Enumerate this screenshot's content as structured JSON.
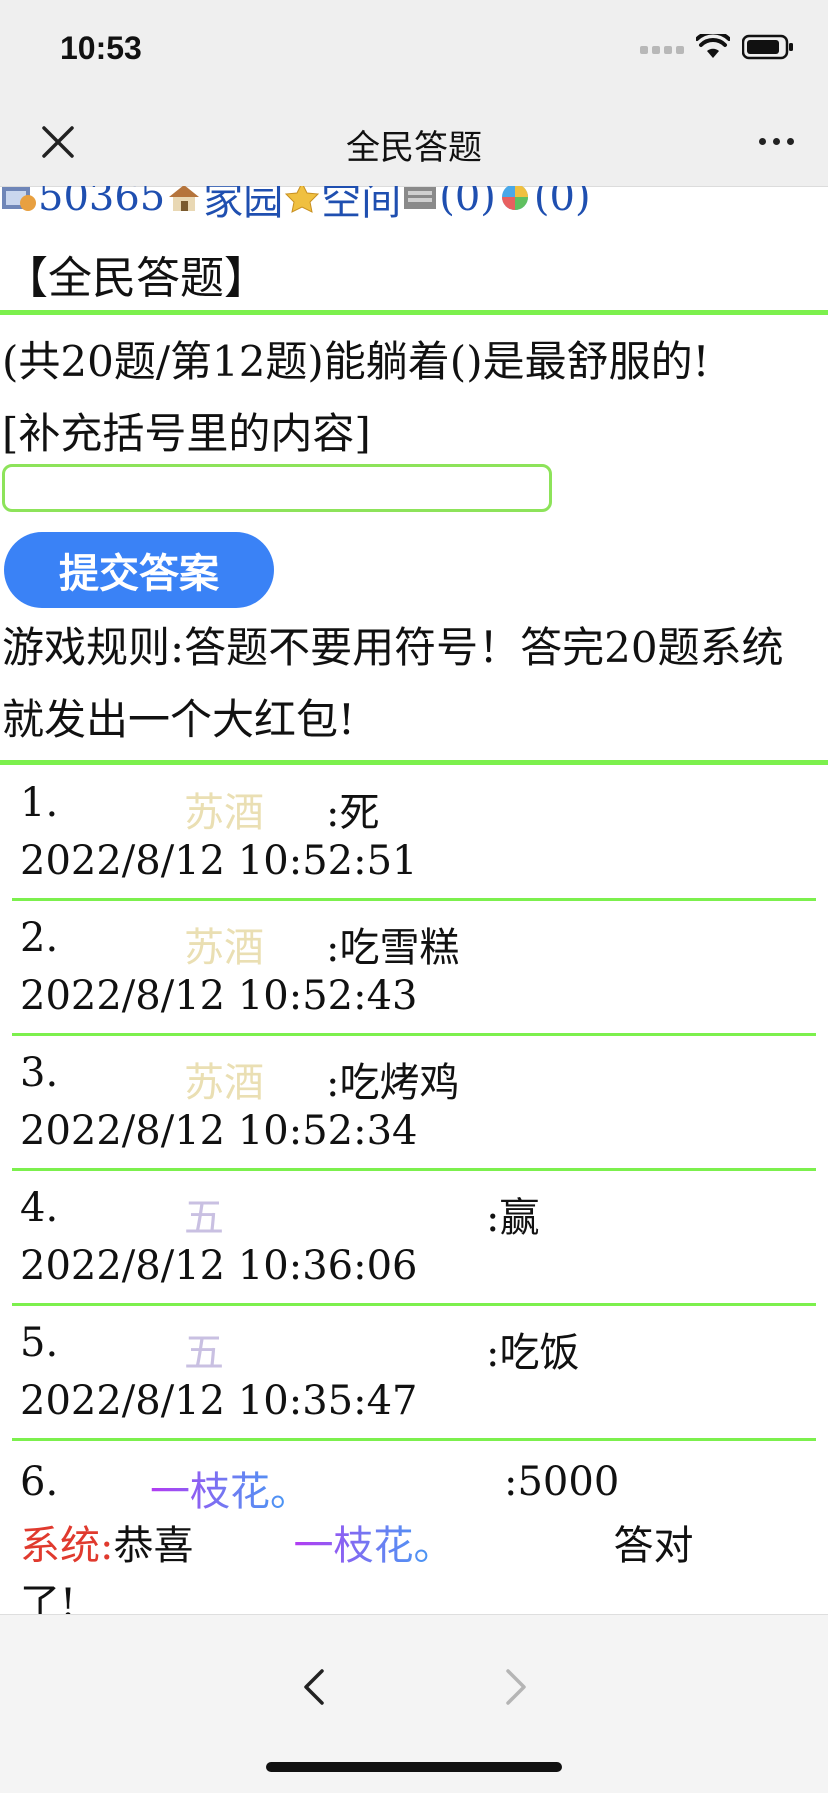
{
  "status_bar": {
    "time": "10:53"
  },
  "nav": {
    "title": "全民答题"
  },
  "user_line": {
    "user_id": "50365",
    "home_label": "家园",
    "space_label": "空间",
    "count1": "(0)",
    "count2": "(0)"
  },
  "page_heading": "【全民答题】",
  "question": {
    "text": "(共20题/第12题)能躺着()是最舒服的!",
    "hint": "[补充括号里的内容]"
  },
  "answer_input": {
    "value": "",
    "placeholder": ""
  },
  "submit_label": "提交答案",
  "rules": "游戏规则:答题不要用符号！答完20题系统就发出一个大红包!",
  "answers": [
    {
      "num": "1.",
      "name": "苏酒",
      "answer": ":死",
      "time": "2022/8/12 10:52:51",
      "name_color": "#eadfb3"
    },
    {
      "num": "2.",
      "name": "苏酒",
      "answer": ":吃雪糕",
      "time": "2022/8/12 10:52:43",
      "name_color": "#eadfb3"
    },
    {
      "num": "3.",
      "name": "苏酒",
      "answer": ":吃烤鸡",
      "time": "2022/8/12 10:52:34",
      "name_color": "#eadfb3"
    },
    {
      "num": "4.",
      "name": "五",
      "answer": ":赢",
      "time": "2022/8/12 10:36:06",
      "name_color": "#c9c0e2"
    },
    {
      "num": "5.",
      "name": "五",
      "answer": ":吃饭",
      "time": "2022/8/12 10:35:47",
      "name_color": "#c9c0e2"
    }
  ],
  "last_answer": {
    "num": "6.",
    "name": "一枝花。",
    "answer": ":5000",
    "system_label": "系统:",
    "congrats": "恭喜",
    "winner": "一枝花。",
    "correct": "答对",
    "correct_tail": "了!"
  },
  "colors": {
    "accent_green": "#7cf04d",
    "button_blue": "#3a82f6",
    "system_red": "#e03a2e",
    "link_blue": "#1f4fb0"
  }
}
